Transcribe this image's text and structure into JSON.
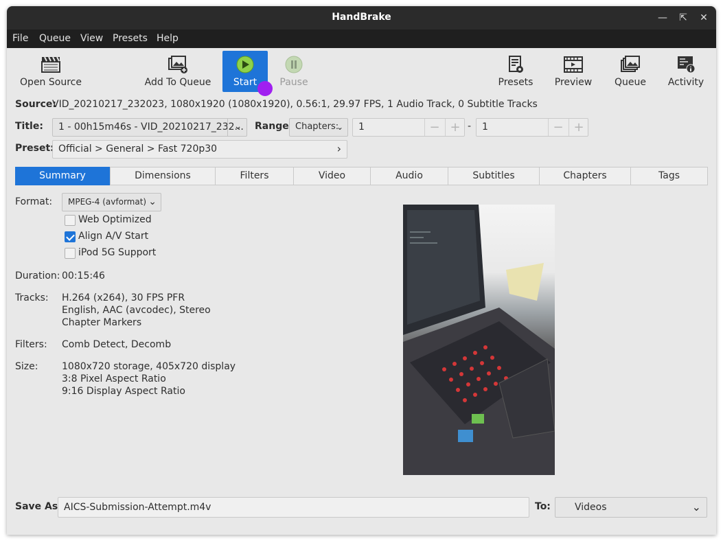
{
  "window": {
    "title": "HandBrake"
  },
  "menu": [
    "File",
    "Queue",
    "View",
    "Presets",
    "Help"
  ],
  "toolbar": {
    "open_source": "Open Source",
    "add_to_queue": "Add To Queue",
    "start": "Start",
    "pause": "Pause",
    "presets": "Presets",
    "preview": "Preview",
    "queue": "Queue",
    "activity": "Activity"
  },
  "source": {
    "label": "Source:",
    "value": "VID_20210217_232023, 1080x1920 (1080x1920), 0.56:1, 29.97 FPS, 1 Audio Track, 0 Subtitle Tracks"
  },
  "title_row": {
    "label": "Title:",
    "value": "1 - 00h15m46s - VID_20210217_232...",
    "range_label": "Range:",
    "range_mode": "Chapters:",
    "range_start": "1",
    "range_sep": "-",
    "range_end": "1"
  },
  "preset": {
    "label": "Preset:",
    "value": "Official > General > Fast 720p30"
  },
  "tabs": [
    "Summary",
    "Dimensions",
    "Filters",
    "Video",
    "Audio",
    "Subtitles",
    "Chapters",
    "Tags"
  ],
  "summary": {
    "format_label": "Format:",
    "format_value": "MPEG-4 (avformat)",
    "web_optimized": "Web Optimized",
    "align_av": "Align A/V Start",
    "ipod": "iPod 5G Support",
    "checks": {
      "web_optimized": false,
      "align_av": true,
      "ipod": false
    },
    "duration_label": "Duration:",
    "duration": "00:15:46",
    "tracks_label": "Tracks:",
    "tracks": [
      "H.264 (x264), 30 FPS PFR",
      "English, AAC (avcodec), Stereo",
      "Chapter Markers"
    ],
    "filters_label": "Filters:",
    "filters": "Comb Detect, Decomb",
    "size_label": "Size:",
    "size": [
      "1080x720 storage, 405x720 display",
      "3:8 Pixel Aspect Ratio",
      "9:16 Display Aspect Ratio"
    ]
  },
  "save": {
    "label": "Save As:",
    "value": "AICS-Submission-Attempt.m4v",
    "to_label": "To:",
    "to_value": "Videos"
  },
  "colors": {
    "accent": "#1e74d8",
    "titlebar": "#2b2b2b",
    "menubar": "#1f1f1f",
    "cursor": "#a020f0"
  }
}
